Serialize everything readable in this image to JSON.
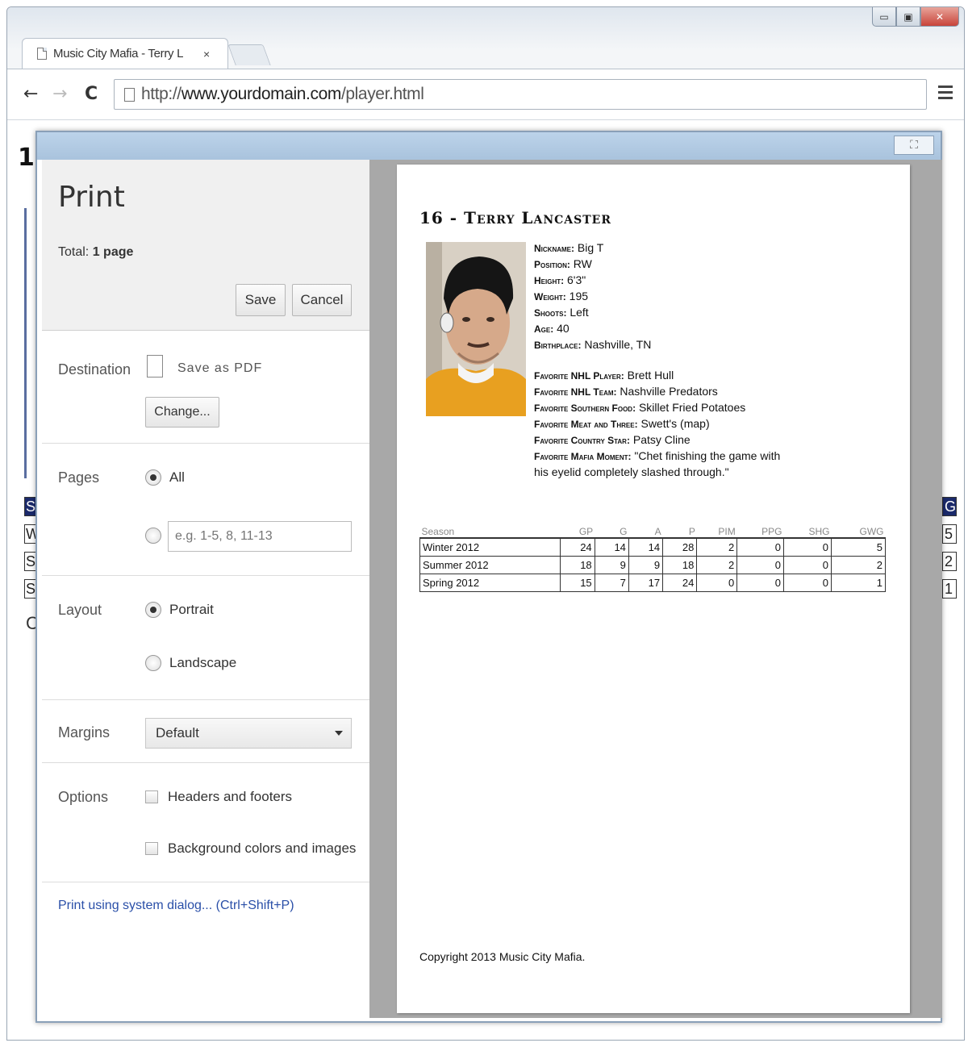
{
  "window": {
    "controls": [
      "▭",
      "▣",
      "✕"
    ]
  },
  "tab": {
    "title": "Music City Mafia - Terry L",
    "close": "×"
  },
  "toolbar": {
    "back": "←",
    "forward": "→",
    "reload": "C",
    "url_prefix": "http://",
    "url_domain": "www.yourdomain.com",
    "url_path": "/player.html"
  },
  "background_page": {
    "heading_peek": "1",
    "left_rows": [
      "S",
      "W",
      "S",
      "S"
    ],
    "right_rows": [
      "G",
      "5",
      "2",
      "1"
    ],
    "left_link_peek": "C"
  },
  "dialog": {
    "close_glyph": "⛶",
    "title": "Print",
    "total_label": "Total:",
    "total_value": "1 page",
    "save": "Save",
    "cancel": "Cancel",
    "destination": {
      "label": "Destination",
      "value": "Save as PDF",
      "change": "Change..."
    },
    "pages": {
      "label": "Pages",
      "all": "All",
      "placeholder": "e.g. 1-5, 8, 11-13"
    },
    "layout": {
      "label": "Layout",
      "portrait": "Portrait",
      "landscape": "Landscape"
    },
    "margins": {
      "label": "Margins",
      "value": "Default"
    },
    "options": {
      "label": "Options",
      "headers": "Headers and footers",
      "background": "Background colors and images"
    },
    "system_dialog": "Print using system dialog... (Ctrl+Shift+P)"
  },
  "preview": {
    "title": "16 - Terry Lancaster",
    "bio": [
      {
        "k": "Nickname:",
        "v": " Big T"
      },
      {
        "k": "Position:",
        "v": " RW"
      },
      {
        "k": "Height:",
        "v": " 6'3\""
      },
      {
        "k": "Weight:",
        "v": " 195"
      },
      {
        "k": "Shoots:",
        "v": " Left"
      },
      {
        "k": "Age:",
        "v": " 40"
      },
      {
        "k": "Birthplace:",
        "v": " Nashville, TN"
      }
    ],
    "favorites": [
      {
        "k": "Favorite NHL Player:",
        "v": " Brett Hull"
      },
      {
        "k": "Favorite NHL Team:",
        "v": " Nashville Predators"
      },
      {
        "k": "Favorite Southern Food:",
        "v": " Skillet Fried Potatoes"
      },
      {
        "k": "Favorite Meat and Three:",
        "v": " Swett's (map)"
      },
      {
        "k": "Favorite Country Star:",
        "v": " Patsy Cline"
      },
      {
        "k": "Favorite Mafia Moment:",
        "v": " \"Chet finishing the game with his eyelid completely slashed through.\""
      }
    ],
    "table": {
      "headers": [
        "Season",
        "GP",
        "G",
        "A",
        "P",
        "PIM",
        "PPG",
        "SHG",
        "GWG"
      ],
      "rows": [
        [
          "Winter 2012",
          "24",
          "14",
          "14",
          "28",
          "2",
          "0",
          "0",
          "5"
        ],
        [
          "Summer 2012",
          "18",
          "9",
          "9",
          "18",
          "2",
          "0",
          "0",
          "2"
        ],
        [
          "Spring 2012",
          "15",
          "7",
          "17",
          "24",
          "0",
          "0",
          "0",
          "1"
        ]
      ]
    },
    "copyright": "Copyright 2013 Music City Mafia."
  }
}
